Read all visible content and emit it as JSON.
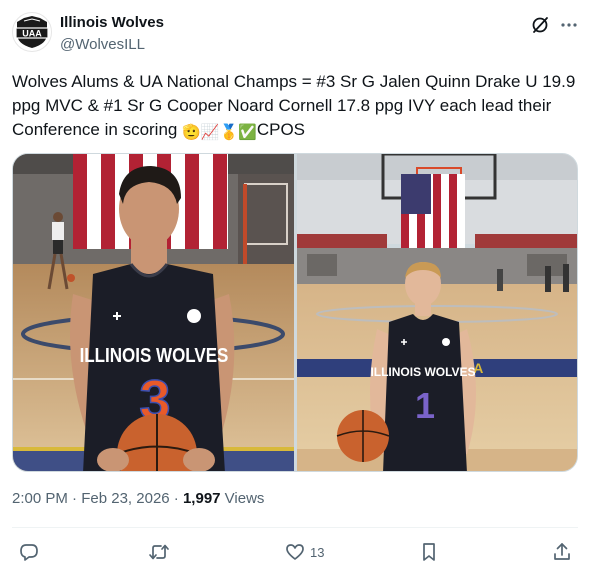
{
  "author": {
    "name": "Illinois Wolves",
    "handle": "@WolvesILL",
    "avatar_text": "UAA"
  },
  "tweet": {
    "text": "Wolves Alums & UA National Champs = #3 Sr G Jalen Quinn Drake U 19.9 ppg MVC & #1 Sr G Cooper Noard Cornell 17.8 ppg IVY each lead their Conference in scoring ",
    "emojis": [
      "🫡",
      "📈",
      "🥇",
      "✅"
    ],
    "tail": "CPOS"
  },
  "media": {
    "left_jersey": {
      "team": "ILLINOIS WOLVES",
      "number": "3"
    },
    "right_jersey": {
      "team": "ILLINOIS WOLVES",
      "number": "1"
    },
    "court_text": "U S A"
  },
  "meta": {
    "time": "2:00 PM",
    "separator": " · ",
    "date": "Feb 23, 2026",
    "views_count": "1,997",
    "views_label": " Views"
  },
  "actions": {
    "like_count": "13"
  },
  "icons": {
    "grok": "grok-icon",
    "more": "more-icon",
    "reply": "reply-icon",
    "retweet": "retweet-icon",
    "like": "heart-icon",
    "bookmark": "bookmark-icon",
    "share": "share-icon"
  },
  "colors": {
    "text": "#0f1419",
    "secondary": "#536471",
    "border": "#cfd9de",
    "jersey": "#1b1d27",
    "jersey_number": "#e85a2a",
    "right_number": "#7a63c9"
  }
}
